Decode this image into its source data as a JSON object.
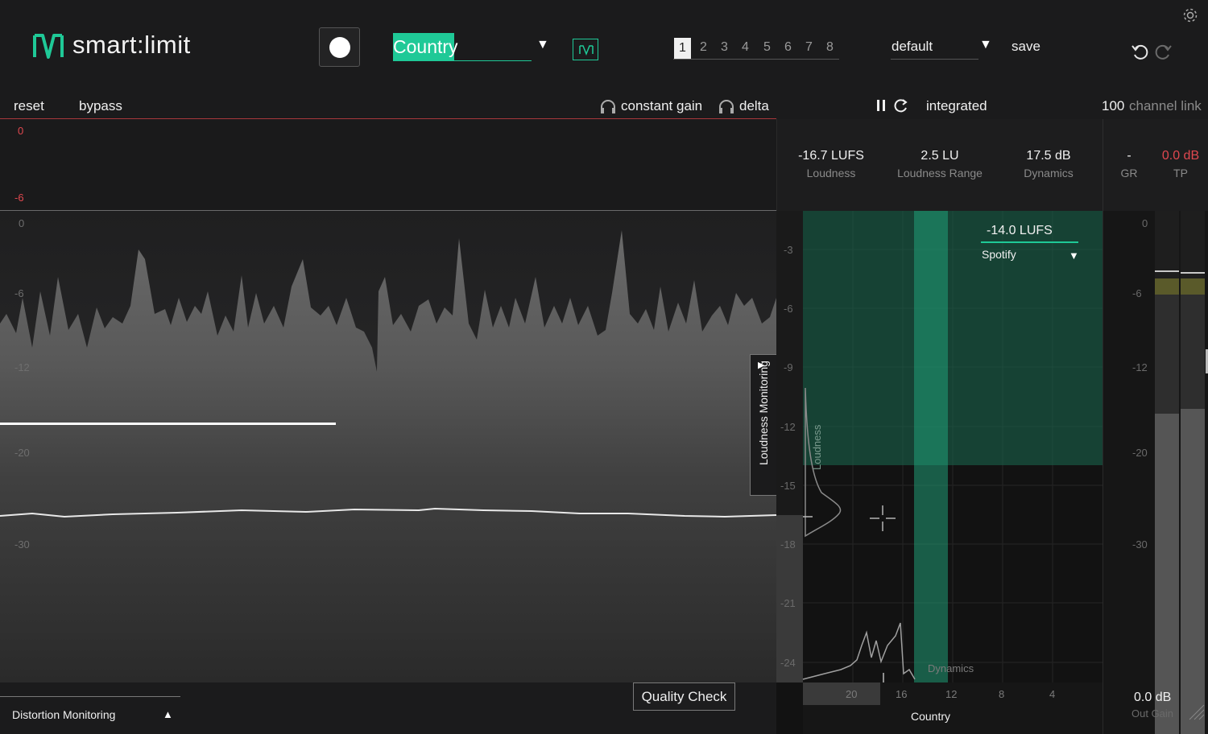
{
  "header": {
    "app_name": "smart:limit",
    "genre": "Country",
    "slots": [
      "1",
      "2",
      "3",
      "4",
      "5",
      "6",
      "7",
      "8"
    ],
    "active_slot": "1",
    "preset_name": "default",
    "save_label": "save",
    "icons": [
      "smart-limit-logo-icon",
      "record-icon",
      "profile-select-icon",
      "undo-icon",
      "redo-icon",
      "settings-gear-icon"
    ]
  },
  "toolbar": {
    "reset_label": "reset",
    "bypass_label": "bypass",
    "constant_gain_label": "constant gain",
    "delta_label": "delta",
    "integrated_label": "integrated",
    "channel_link_value": "100",
    "channel_link_label": "channel link"
  },
  "gain_reduction": {
    "scale": [
      "0",
      "-6"
    ]
  },
  "waveform": {
    "scale": [
      "0",
      "-6",
      "-12",
      "-20",
      "-30"
    ]
  },
  "stats": [
    {
      "value": "-16.7 LUFS",
      "label": "Loudness"
    },
    {
      "value": "2.5 LU",
      "label": "Loudness Range"
    },
    {
      "value": "17.5 dB",
      "label": "Dynamics"
    },
    {
      "value": "-",
      "label": "GR"
    },
    {
      "value": "0.0 dB",
      "label": "TP"
    }
  ],
  "loudness_plot": {
    "target_value": "-14.0 LUFS",
    "target_platform": "Spotify",
    "y_axis_label": "Loudness",
    "x_axis_label": "Dynamics",
    "genre_label": "Country",
    "y_ticks": [
      "-3",
      "-6",
      "-9",
      "-12",
      "-15",
      "-18",
      "-21",
      "-24"
    ],
    "x_ticks": [
      "20",
      "16",
      "12",
      "8",
      "4"
    ]
  },
  "meters": {
    "scale": [
      "0",
      "-6",
      "-12",
      "-20",
      "-30"
    ],
    "out_gain_value": "0.0 dB",
    "out_gain_label": "Out Gain"
  },
  "bottom": {
    "distortion_label": "Distortion Monitoring",
    "quality_check_label": "Quality Check",
    "loudness_monitoring_label": "Loudness Monitoring"
  },
  "colors": {
    "accent": "#1fc997",
    "true_peak": "#e0484f"
  }
}
